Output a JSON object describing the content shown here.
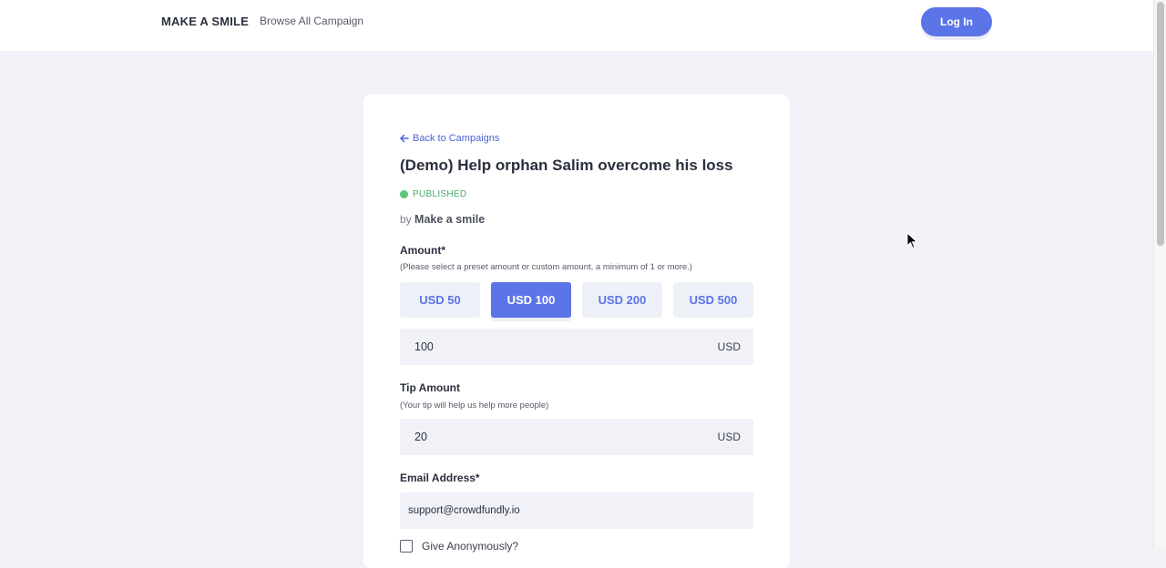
{
  "header": {
    "brand": "MAKE A SMILE",
    "nav_link": "Browse All Campaign",
    "login_label": "Log In"
  },
  "campaign": {
    "back_label": "Back to Campaigns",
    "title": "(Demo) Help orphan Salim overcome his loss",
    "status": "PUBLISHED",
    "by_prefix": "by",
    "organizer": "Make a smile"
  },
  "form": {
    "amount_label": "Amount*",
    "amount_hint": "(Please select a preset amount or custom amount, a minimum of 1 or more.)",
    "presets": [
      "USD 50",
      "USD 100",
      "USD 200",
      "USD 500"
    ],
    "selected_preset": "USD 100",
    "amount_value": "100",
    "amount_currency": "USD",
    "tip_label": "Tip Amount",
    "tip_hint": "(Your tip will help us help more people)",
    "tip_value": "20",
    "tip_currency": "USD",
    "email_label": "Email Address*",
    "email_value": "support@crowdfundly.io",
    "anonymous_label": "Give Anonymously?"
  },
  "colors": {
    "accent": "#5b74e8",
    "published": "#5cc67c",
    "page_bg": "#f1f2f7"
  }
}
